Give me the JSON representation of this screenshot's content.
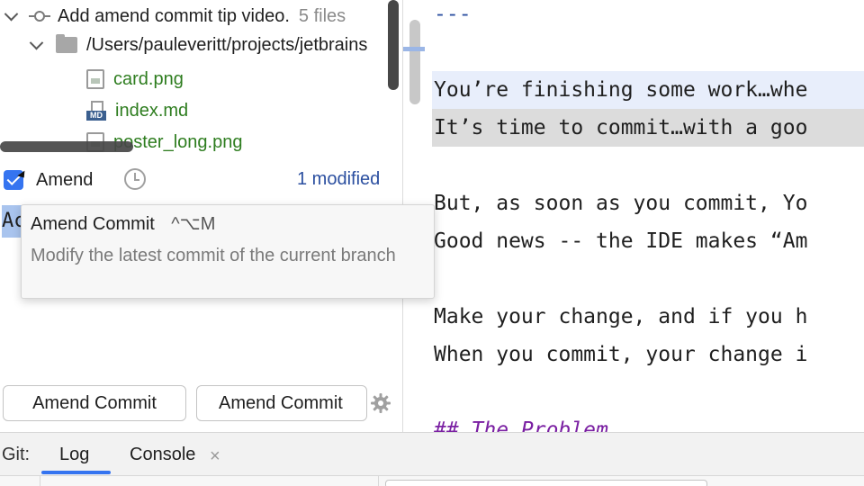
{
  "commit_tree": {
    "commit_message": "Add amend commit tip video.",
    "file_count": "5 files",
    "folder_path": "/Users/pauleveritt/projects/jetbrains",
    "files": [
      {
        "name": "card.png",
        "icon": "image-file-icon"
      },
      {
        "name": "index.md",
        "icon": "markdown-file-icon",
        "tag": "MD"
      },
      {
        "name": "poster_long.png",
        "icon": "image-file-icon"
      }
    ]
  },
  "amend": {
    "label": "Amend",
    "checked": true,
    "modified_count": "1 modified"
  },
  "commit_message_field": {
    "value": "Ac"
  },
  "tooltip": {
    "title": "Amend Commit",
    "shortcut": "^⌥M",
    "description": "Modify the latest commit of the current branch"
  },
  "buttons": {
    "amend_commit": "Amend Commit",
    "amend_commit_and_push": "Amend Commit"
  },
  "editor": {
    "lines": [
      {
        "text": "---",
        "style": "dash"
      },
      {
        "text": "You’re finishing some work…whe",
        "style": "normal"
      },
      {
        "text": "It’s time to commit…with a goo",
        "style": "normal"
      },
      {
        "text": "But, as soon as you commit, Yo",
        "style": "normal"
      },
      {
        "text": "Good news -- the IDE makes “Am",
        "style": "normal"
      },
      {
        "text": "Make your change, and if you h",
        "style": "normal"
      },
      {
        "text": "When you commit, your change i",
        "style": "normal"
      },
      {
        "text": "## The Problem",
        "style": "heading"
      }
    ]
  },
  "bottom_bar": {
    "git_label": "Git:",
    "tabs": [
      {
        "label": "Log",
        "active": true
      },
      {
        "label": "Console",
        "closable": true
      }
    ],
    "close_glyph": "×"
  },
  "colors": {
    "accent": "#3574f0",
    "file_added_green": "#2e7d1f",
    "modified_link": "#2b4fa0",
    "heading_purple": "#7a1fa2"
  }
}
